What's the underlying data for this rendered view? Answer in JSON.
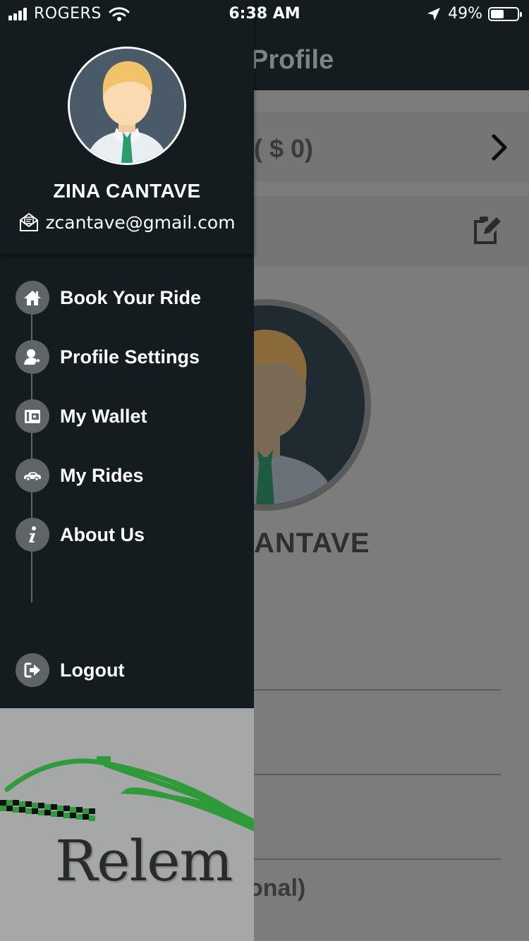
{
  "status_bar": {
    "carrier": "ROGERS",
    "time": "6:38 AM",
    "battery": "49%"
  },
  "background_page": {
    "title": "Profile",
    "balance": "( $ 0)",
    "name_fragment": "ANTAVE",
    "optional_fragment": "onal)"
  },
  "drawer": {
    "user": {
      "name": "ZINA CANTAVE",
      "email": "zcantave@gmail.com"
    },
    "menu": [
      {
        "label": "Book Your Ride",
        "icon": "home-icon"
      },
      {
        "label": "Profile Settings",
        "icon": "user-settings-icon"
      },
      {
        "label": "My Wallet",
        "icon": "wallet-icon"
      },
      {
        "label": "My Rides",
        "icon": "car-icon"
      },
      {
        "label": "About Us",
        "icon": "info-icon"
      }
    ],
    "logout": {
      "label": "Logout",
      "icon": "logout-icon"
    }
  },
  "brand": {
    "logo_text": "Relem",
    "logo_color": "#2e9a3a"
  },
  "colors": {
    "drawer_bg": "#141c1f",
    "icon_circle": "#5f6467",
    "overlay_bg": "#7c7c7c"
  }
}
